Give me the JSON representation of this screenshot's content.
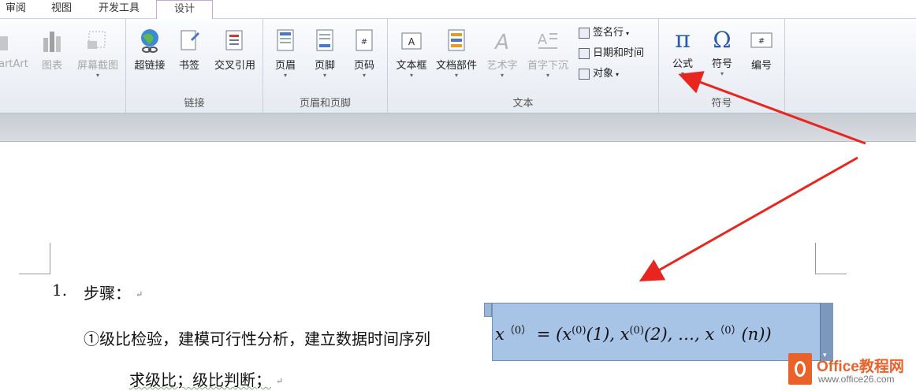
{
  "tabs": [
    {
      "label": "审阅"
    },
    {
      "label": "视图"
    },
    {
      "label": "开发工具"
    },
    {
      "label": "设计"
    }
  ],
  "ribbon": {
    "illustrations": {
      "smartart": "artArt",
      "chart": "图表",
      "screenshot": "屏幕截图"
    },
    "links": {
      "label": "链接",
      "hyperlink": "超链接",
      "bookmark": "书签",
      "crossref": "交叉引用"
    },
    "header_footer": {
      "label": "页眉和页脚",
      "header": "页眉",
      "footer": "页脚",
      "page_number": "页码"
    },
    "text": {
      "label": "文本",
      "textbox": "文本框",
      "quickparts": "文档部件",
      "wordart": "艺术字",
      "dropcap": "首字下沉",
      "signature": "签名行",
      "datetime": "日期和时间",
      "object": "对象"
    },
    "symbols": {
      "label": "符号",
      "equation": "公式",
      "symbol": "符号",
      "numbering": "编号"
    }
  },
  "document": {
    "list_number": "1.",
    "step_heading": "步骤：",
    "line2_prefix": "①级比检验，建模可行性分析，建立数据时间序列",
    "line3": "求级比；级比判断；",
    "equation": {
      "x_start": "x",
      "sup0": "（0）",
      "mid": " = (x",
      "sup1": "(0)",
      "t1": "(1), x",
      "sup2": "(0)",
      "t2": "(2), …, x",
      "sup3": "（0）",
      "t3": "(n))"
    }
  },
  "watermark": {
    "title": "Office教程网",
    "url": "www.office26.com"
  },
  "colors": {
    "arrow": "#e8261f",
    "equation_highlight": "#a7c3e6",
    "brand": "#e8622a"
  }
}
